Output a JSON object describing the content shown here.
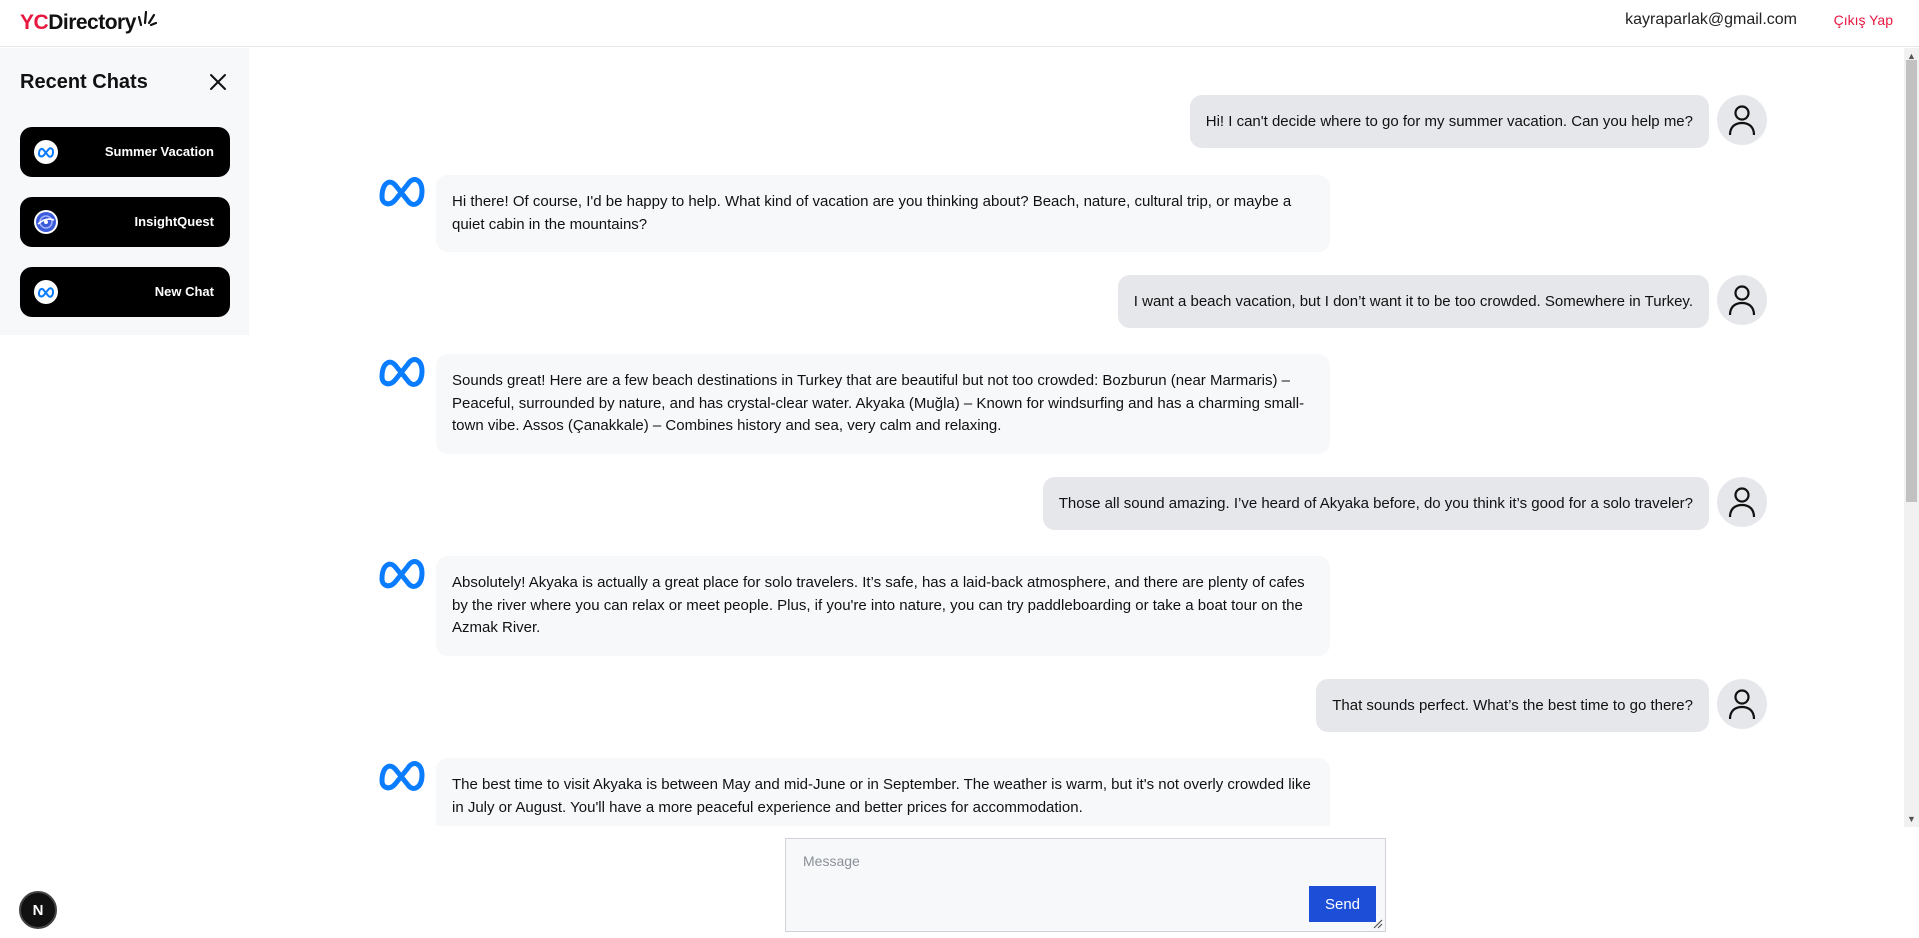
{
  "header": {
    "logo_prefix": "YC",
    "logo_suffix": "Directory",
    "user_email": "kayraparlak@gmail.com",
    "logout_label": "Çıkış Yap"
  },
  "sidebar": {
    "title": "Recent Chats",
    "items": [
      {
        "label": "Summer Vacation",
        "icon": "meta-logo-icon"
      },
      {
        "label": "InsightQuest",
        "icon": "insightquest-globe-icon"
      },
      {
        "label": "New Chat",
        "icon": "meta-logo-icon"
      }
    ]
  },
  "messages": [
    {
      "role": "user",
      "text": "Hi! I can't decide where to go for my summer vacation. Can you help me?"
    },
    {
      "role": "bot",
      "text": "Hi there! Of course, I'd be happy to help. What kind of vacation are you thinking about? Beach, nature, cultural trip, or maybe a quiet cabin in the mountains?"
    },
    {
      "role": "user",
      "text": "I want a beach vacation, but I don’t want it to be too crowded. Somewhere in Turkey."
    },
    {
      "role": "bot",
      "text": "Sounds great! Here are a few beach destinations in Turkey that are beautiful but not too crowded: Bozburun (near Marmaris) – Peaceful, surrounded by nature, and has crystal-clear water. Akyaka (Muğla) – Known for windsurfing and has a charming small-town vibe. Assos (Çanakkale) – Combines history and sea, very calm and relaxing."
    },
    {
      "role": "user",
      "text": "Those all sound amazing. I’ve heard of Akyaka before, do you think it’s good for a solo traveler?"
    },
    {
      "role": "bot",
      "text": "Absolutely! Akyaka is actually a great place for solo travelers. It’s safe, has a laid-back atmosphere, and there are plenty of cafes by the river where you can relax or meet people. Plus, if you're into nature, you can try paddleboarding or take a boat tour on the Azmak River."
    },
    {
      "role": "user",
      "text": "That sounds perfect. What’s the best time to go there?"
    },
    {
      "role": "bot",
      "text": "The best time to visit Akyaka is between May and mid-June or in September. The weather is warm, but it's not overly crowded like in July or August. You'll have a more peaceful experience and better prices for accommodation."
    }
  ],
  "composer": {
    "placeholder": "Message",
    "value": "",
    "send_label": "Send"
  },
  "next_badge": "N",
  "colors": {
    "brand_red": "#e8173f",
    "send_blue": "#1d4ed8",
    "meta_blue": "#0a7cff"
  }
}
